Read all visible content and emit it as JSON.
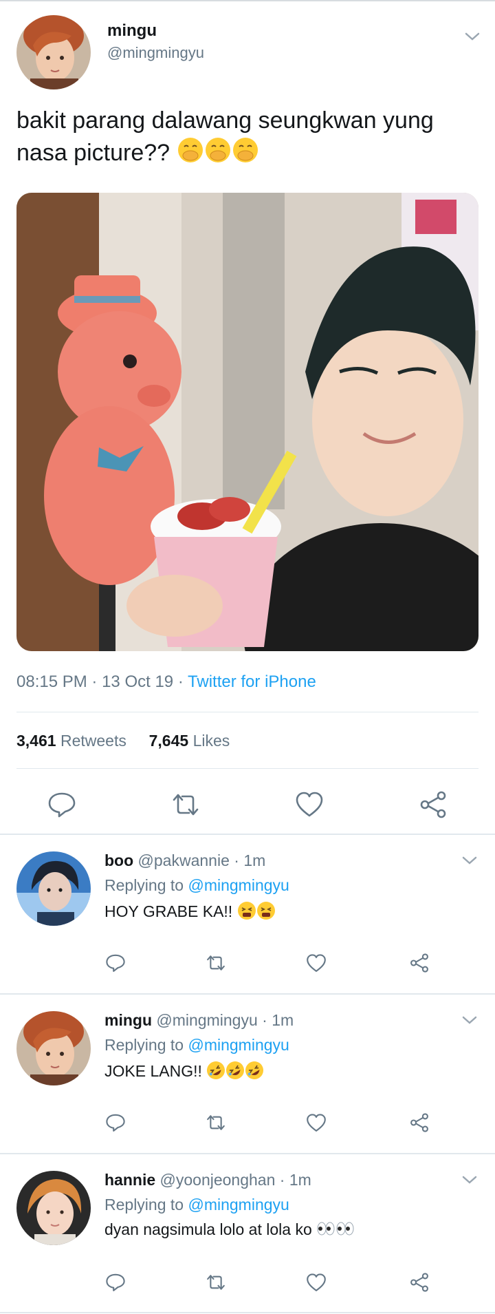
{
  "tweet": {
    "name": "mingu",
    "handle": "@mingmingyu",
    "text": "bakit parang dalawang seungkwan yung nasa picture??",
    "emojis": [
      "hand-over-mouth-emoji",
      "hand-over-mouth-emoji",
      "hand-over-mouth-emoji"
    ],
    "time": "08:15 PM",
    "date": "13 Oct 19",
    "source": "Twitter for iPhone",
    "retweets_count": "3,461",
    "retweets_label": "Retweets",
    "likes_count": "7,645",
    "likes_label": "Likes"
  },
  "replies": [
    {
      "name": "boo",
      "handle": "@pakwannie",
      "age": "1m",
      "replying_prefix": "Replying to",
      "replying_handle": "@mingmingyu",
      "text": "HOY GRABE KA!!",
      "emojis": [
        "tired-face-emoji",
        "tired-face-emoji"
      ]
    },
    {
      "name": "mingu",
      "handle": "@mingmingyu",
      "age": "1m",
      "replying_prefix": "Replying to",
      "replying_handle": "@mingmingyu",
      "text": "JOKE LANG!!",
      "emojis": [
        "rolling-laughing-emoji",
        "rolling-laughing-emoji",
        "rolling-laughing-emoji"
      ]
    },
    {
      "name": "hannie",
      "handle": "@yoonjeonghan",
      "age": "1m",
      "replying_prefix": "Replying to",
      "replying_handle": "@mingmingyu",
      "text": "dyan nagsimula lolo at lola ko",
      "emojis": [
        "eyes-emoji",
        "eyes-emoji"
      ]
    }
  ],
  "colors": {
    "link": "#1da1f2",
    "secondary_text": "#657786",
    "primary_text": "#14171a",
    "divider": "#e1e8ed",
    "icon": "#657786"
  }
}
